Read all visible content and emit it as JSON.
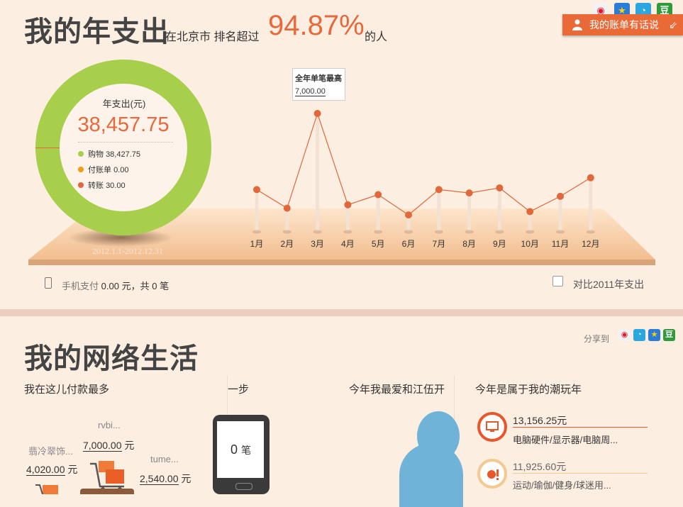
{
  "header": {
    "title": "我的年支出",
    "rank_prefix": "在北京市 排名超过",
    "rank_value": "94.87%",
    "rank_suffix": "的人",
    "talk_button": "我的账单有话说",
    "share_icons": [
      "weibo-icon",
      "qzone-icon",
      "tencent-weibo-icon",
      "douban-icon"
    ]
  },
  "donut": {
    "label": "年支出(元)",
    "total": "38,457.75",
    "legend": [
      {
        "name": "购物",
        "value": "38,427.75",
        "color": "#a7cf4c"
      },
      {
        "name": "付账单",
        "value": "0.00",
        "color": "#f39c12"
      },
      {
        "name": "转账",
        "value": "30.00",
        "color": "#e0683a"
      }
    ],
    "date_range": "2012.1.1-2012.12.31"
  },
  "chart_data": {
    "type": "line",
    "categories": [
      "1月",
      "2月",
      "3月",
      "4月",
      "5月",
      "6月",
      "7月",
      "8月",
      "9月",
      "10月",
      "11月",
      "12月"
    ],
    "values": [
      2500,
      1400,
      7000,
      1600,
      2200,
      1000,
      2500,
      2300,
      2600,
      1200,
      2100,
      3200
    ],
    "annotation": {
      "title": "全年单笔最高",
      "value": "7,000.00",
      "index": 2
    },
    "ylim": [
      0,
      7800
    ],
    "color": "#e0683a"
  },
  "footer": {
    "mobile_label": "手机支付",
    "mobile_amount": "0.00",
    "mobile_unit": "元，共",
    "mobile_count": "0",
    "mobile_count_unit": "笔",
    "compare_label": "对比2011年支出"
  },
  "section2": {
    "title": "我的网络生活",
    "share_to": "分享到",
    "share_icons": [
      "weibo-icon",
      "qzone-icon",
      "tencent-weibo-icon",
      "douban-icon"
    ],
    "panels": [
      {
        "title": "我在这儿付款最多"
      },
      {
        "title": "一步"
      },
      {
        "title": "今年我最爱和江伍开"
      },
      {
        "title": "今年是属于我的潮玩年"
      }
    ],
    "carts": [
      {
        "name": "翡冷翠饰...",
        "value": "4,020.00",
        "unit": "元"
      },
      {
        "name": "rvbi...",
        "value": "7,000.00",
        "unit": "元"
      },
      {
        "name": "tume...",
        "value": "2,540.00",
        "unit": "元"
      }
    ],
    "phone_count": "0",
    "phone_count_unit": "笔",
    "categories": [
      {
        "amount": "13,156.25元",
        "name": "电脑硬件/显示器/电脑周...",
        "color": "#e8562a",
        "icon": "monitor-icon"
      },
      {
        "amount": "11,925.60元",
        "name": "运动/瑜伽/健身/球迷用...",
        "color": "#f0a050",
        "icon": "sports-ball-icon"
      }
    ]
  }
}
